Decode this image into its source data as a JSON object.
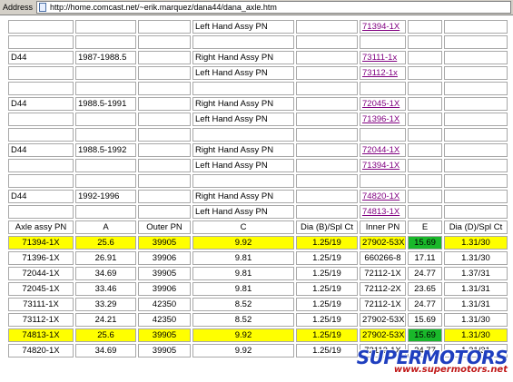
{
  "address_bar": {
    "label": "Address",
    "url": "http://home.comcast.net/~erik.marquez/dana44/dana_axle.htm"
  },
  "upper_rows": [
    {
      "model": "",
      "years": "",
      "side": "Left Hand Assy PN",
      "pn": "71394-1X"
    },
    {
      "model": "",
      "years": "",
      "side": "",
      "pn": ""
    },
    {
      "model": "D44",
      "years": "1987-1988.5",
      "side": "Right Hand Assy PN",
      "pn": "73111-1x"
    },
    {
      "model": "",
      "years": "",
      "side": "Left Hand Assy PN",
      "pn": "73112-1x"
    },
    {
      "model": "",
      "years": "",
      "side": "",
      "pn": ""
    },
    {
      "model": "D44",
      "years": "1988.5-1991",
      "side": "Right Hand Assy PN",
      "pn": "72045-1X"
    },
    {
      "model": "",
      "years": "",
      "side": "Left Hand Assy PN",
      "pn": "71396-1X"
    },
    {
      "model": "",
      "years": "",
      "side": "",
      "pn": ""
    },
    {
      "model": "D44",
      "years": "1988.5-1992",
      "side": "Right Hand Assy PN",
      "pn": "72044-1X"
    },
    {
      "model": "",
      "years": "",
      "side": "Left Hand Assy PN",
      "pn": "71394-1X"
    },
    {
      "model": "",
      "years": "",
      "side": "",
      "pn": ""
    },
    {
      "model": "D44",
      "years": "1992-1996",
      "side": "Right Hand Assy PN",
      "pn": "74820-1X"
    },
    {
      "model": "",
      "years": "",
      "side": "Left Hand Assy PN",
      "pn": "74813-1X"
    }
  ],
  "specs_header": [
    "Axle assy PN",
    "A",
    "Outer PN",
    "C",
    "Dia (B)/Spl Ct",
    "Inner PN",
    "E",
    "Dia (D)/Spl Ct"
  ],
  "specs_rows": [
    {
      "cells": [
        "71394-1X",
        "25.6",
        "39905",
        "9.92",
        "1.25/19",
        "27902-53X",
        "15.69",
        "1.31/30"
      ],
      "highlight": true
    },
    {
      "cells": [
        "71396-1X",
        "26.91",
        "39906",
        "9.81",
        "1.25/19",
        "660266-8",
        "17.11",
        "1.31/30"
      ],
      "highlight": false
    },
    {
      "cells": [
        "72044-1X",
        "34.69",
        "39905",
        "9.81",
        "1.25/19",
        "72112-1X",
        "24.77",
        "1.37/31"
      ],
      "highlight": false
    },
    {
      "cells": [
        "72045-1X",
        "33.46",
        "39906",
        "9.81",
        "1.25/19",
        "72112-2X",
        "23.65",
        "1.31/31"
      ],
      "highlight": false
    },
    {
      "cells": [
        "73111-1X",
        "33.29",
        "42350",
        "8.52",
        "1.25/19",
        "72112-1X",
        "24.77",
        "1.31/31"
      ],
      "highlight": false
    },
    {
      "cells": [
        "73112-1X",
        "24.21",
        "42350",
        "8.52",
        "1.25/19",
        "27902-53X",
        "15.69",
        "1.31/30"
      ],
      "highlight": false
    },
    {
      "cells": [
        "74813-1X",
        "25.6",
        "39905",
        "9.92",
        "1.25/19",
        "27902-53X",
        "15.69",
        "1.31/30"
      ],
      "highlight": true
    },
    {
      "cells": [
        "74820-1X",
        "34.69",
        "39905",
        "9.92",
        "1.25/19",
        "72112-1X",
        "24.77",
        "1.31/31"
      ],
      "highlight": false
    }
  ],
  "colors": {
    "highlight": "#ffff00",
    "e_highlight": "#19b82a",
    "link": "#800080"
  },
  "watermark": {
    "logo": "SUPERMOTORS",
    "url": "www.supermotors.net"
  }
}
